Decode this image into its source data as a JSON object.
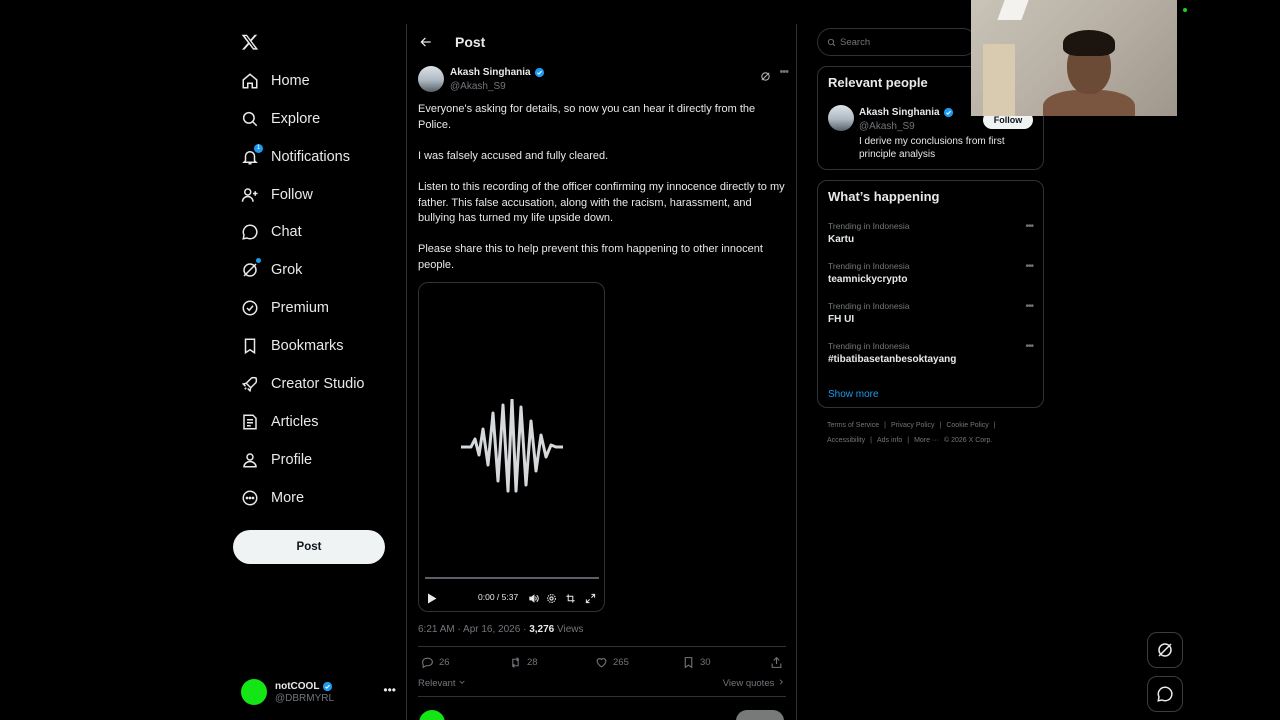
{
  "nav": {
    "items": [
      {
        "label": "Home",
        "icon": "home-icon"
      },
      {
        "label": "Explore",
        "icon": "search-icon"
      },
      {
        "label": "Notifications",
        "icon": "bell-icon",
        "badge": "1"
      },
      {
        "label": "Follow",
        "icon": "person-plus-icon"
      },
      {
        "label": "Chat",
        "icon": "chat-bubble-icon"
      },
      {
        "label": "Grok",
        "icon": "grok-icon"
      },
      {
        "label": "Premium",
        "icon": "verified-badge-icon"
      },
      {
        "label": "Bookmarks",
        "icon": "bookmark-icon"
      },
      {
        "label": "Creator Studio",
        "icon": "rocket-icon"
      },
      {
        "label": "Articles",
        "icon": "article-icon"
      },
      {
        "label": "Profile",
        "icon": "person-icon"
      },
      {
        "label": "More",
        "icon": "more-circle-icon"
      }
    ],
    "post_button": "Post"
  },
  "account": {
    "name": "notCOOL",
    "handle": "@DBRMYRL",
    "avatar_color": "#14e514"
  },
  "header": {
    "title": "Post"
  },
  "post": {
    "author_name": "Akash Singhania",
    "author_handle": "@Akash_S9",
    "paragraphs": [
      "Everyone's asking for details, so now you can hear it directly from the Police.",
      "I was falsely accused and fully cleared.",
      "Listen to this recording of the officer confirming my innocence directly to my father. This false accusation, along with the racism, harassment, and bullying has turned my life upside down.",
      "Please share this to help prevent this from happening to other innocent people."
    ],
    "video": {
      "time": "0:00 / 5:37",
      "progress": 0
    },
    "timestamp": "6:21 AM · Apr 16, 2026 · ",
    "views_count": "3,276",
    "views_label": " Views",
    "replies": "26",
    "reposts": "28",
    "likes": "265",
    "bookmarks": "30",
    "sort_label": "Relevant",
    "view_quotes": "View quotes"
  },
  "search": {
    "placeholder": "Search"
  },
  "relevant_people": {
    "title": "Relevant people",
    "name": "Akash Singhania",
    "handle": "@Akash_S9",
    "bio": "I derive my conclusions from first principle analysis",
    "follow_label": "Follow"
  },
  "whats_happening": {
    "title": "What’s happening",
    "trends": [
      {
        "context": "Trending in Indonesia",
        "name": "Kartu"
      },
      {
        "context": "Trending in Indonesia",
        "name": "teamnickycrypto"
      },
      {
        "context": "Trending in Indonesia",
        "name": "FH UI"
      },
      {
        "context": "Trending in Indonesia",
        "name": "#tibatibasetanbesoktayang"
      }
    ],
    "show_more": "Show more"
  },
  "footer": {
    "row1": [
      "Terms of Service",
      "|",
      "Privacy Policy",
      "|",
      "Cookie Policy",
      "|"
    ],
    "row2": [
      "Accessibility",
      "|",
      "Ads info",
      "|",
      "More ···",
      "© 2026 X Corp."
    ]
  },
  "colors": {
    "accent": "#1d9bf0",
    "background": "#000000",
    "border": "#2f3336",
    "muted_text": "#71767b"
  }
}
